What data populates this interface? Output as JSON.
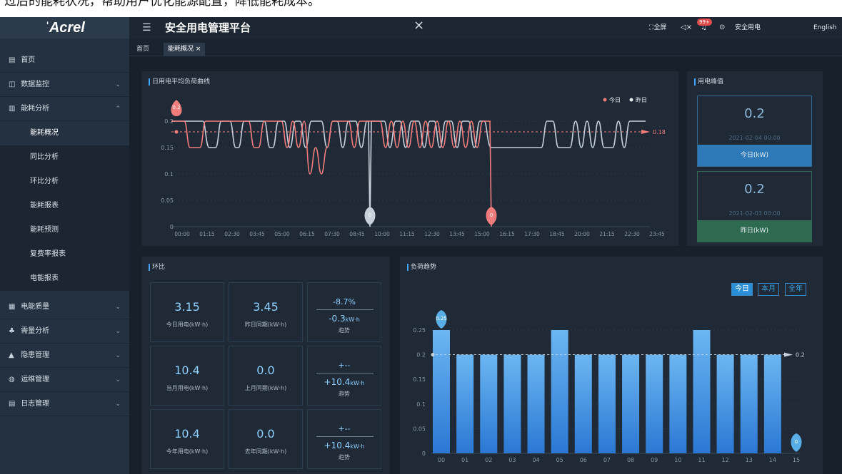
{
  "caption": "过后的能耗状况，帮助用户优化能源配置，降低能耗成本。",
  "sidebar": {
    "logo": "Acrel",
    "items": [
      {
        "label": "首页",
        "icon": "home-icon",
        "glyph": "▤"
      },
      {
        "label": "数据监控",
        "icon": "monitor-icon",
        "glyph": "◫"
      },
      {
        "label": "能耗分析",
        "icon": "bar-chart-icon",
        "glyph": "▥"
      }
    ],
    "subitems": [
      "能耗概况",
      "同比分析",
      "环比分析",
      "能耗报表",
      "能耗预测",
      "复费率报表",
      "电能报表"
    ],
    "items2": [
      {
        "label": "电能质量",
        "icon": "calendar-icon",
        "glyph": "▦"
      },
      {
        "label": "需量分析",
        "icon": "network-icon",
        "glyph": "♣"
      },
      {
        "label": "隐患管理",
        "icon": "warning-icon",
        "glyph": "▲"
      },
      {
        "label": "运维管理",
        "icon": "wrench-icon",
        "glyph": "◍"
      },
      {
        "label": "日志管理",
        "icon": "log-icon",
        "glyph": "▤"
      }
    ]
  },
  "header": {
    "title": "安全用电管理平台",
    "fullscreen": "全屏",
    "badge": "99+",
    "user": "安全用电",
    "lang": "English"
  },
  "tabs": {
    "home": "首页",
    "active": "能耗概况"
  },
  "daily": {
    "title": "日用电平均负荷曲线",
    "legend_today": "今日",
    "legend_yesterday": "昨日",
    "avg_label": "0.18",
    "pin_top": "0.2",
    "pin_y": "0",
    "pin_t": "0",
    "yticks": [
      "0.2",
      "0.15",
      "0.1",
      "0.05",
      "0"
    ],
    "xticks": [
      "00:00",
      "01:15",
      "02:30",
      "03:45",
      "05:00",
      "06:15",
      "07:30",
      "08:45",
      "10:00",
      "11:15",
      "12:30",
      "13:45",
      "15:00",
      "16:15",
      "17:30",
      "18:45",
      "20:00",
      "21:15",
      "22:30",
      "23:45"
    ],
    "colors": {
      "today": "#f07c7c",
      "yesterday": "#c5d0da"
    }
  },
  "peak": {
    "title": "用电峰值",
    "today": {
      "value": "0.2",
      "date": "2021-02-04 00:00",
      "label": "今日(kW)",
      "color": "#2e79b8"
    },
    "yesterday": {
      "value": "0.2",
      "date": "2021-02-03 00:00",
      "label": "昨日(kW)",
      "color": "#2e6a4f"
    }
  },
  "ring": {
    "title": "环比",
    "rows": [
      {
        "cur": "3.15",
        "cur_l": "今日用电(kW·h)",
        "prev": "3.45",
        "prev_l": "昨日同期(kW·h)",
        "pct": "-8.7%",
        "diff": "-0.3",
        "unit": "kW·h",
        "trend": "趋势"
      },
      {
        "cur": "10.4",
        "cur_l": "当月用电(kW·h)",
        "prev": "0.0",
        "prev_l": "上月同期(kW·h)",
        "pct": "+--",
        "diff": "+10.4",
        "unit": "kW·h",
        "trend": "趋势"
      },
      {
        "cur": "10.4",
        "cur_l": "今年用电(kW·h)",
        "prev": "0.0",
        "prev_l": "去年同期(kW·h)",
        "pct": "+--",
        "diff": "+10.4",
        "unit": "kW·h",
        "trend": "趋势"
      }
    ]
  },
  "trend": {
    "title": "负荷趋势",
    "buttons": [
      "今日",
      "本月",
      "全年"
    ],
    "avg_label": "0.2",
    "pin_max": "0.25",
    "pin_min": "0",
    "yticks": [
      "0.25",
      "0.2",
      "0.15",
      "0.1",
      "0.05",
      "0"
    ]
  },
  "chart_data": {
    "type": "bar",
    "title": "负荷趋势",
    "categories": [
      "00",
      "01",
      "02",
      "03",
      "04",
      "05",
      "06",
      "07",
      "08",
      "09",
      "10",
      "11",
      "12",
      "13",
      "14",
      "15"
    ],
    "values": [
      0.25,
      0.2,
      0.2,
      0.2,
      0.2,
      0.25,
      0.2,
      0.2,
      0.2,
      0.2,
      0.2,
      0.25,
      0.2,
      0.2,
      0.2,
      0
    ],
    "ylim": [
      0,
      0.25
    ],
    "average": 0.2,
    "bar_color": "#3b8fe0"
  }
}
